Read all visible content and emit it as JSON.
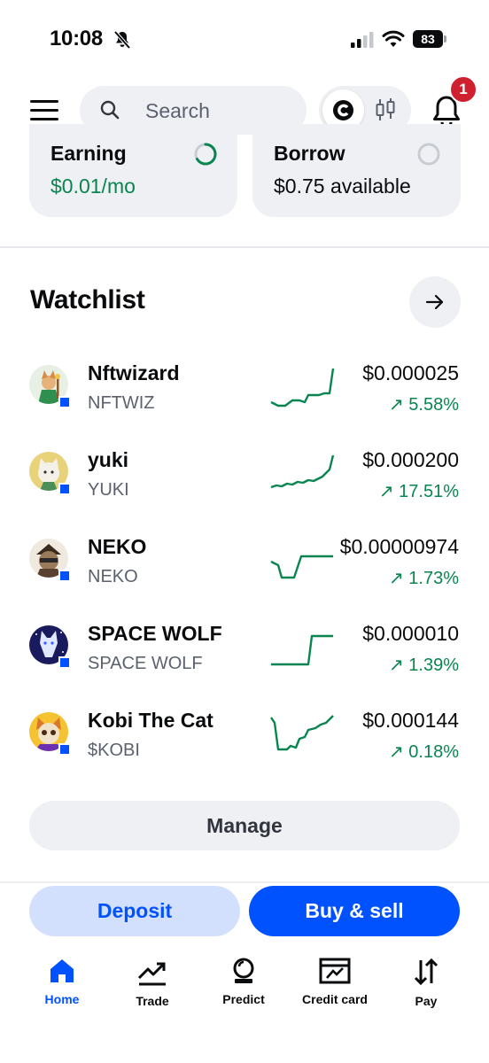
{
  "status_bar": {
    "time": "10:08",
    "battery": "83"
  },
  "header": {
    "search_placeholder": "Search",
    "notification_count": "1"
  },
  "cards": {
    "earning": {
      "title": "Earning",
      "value": "$0.01/mo"
    },
    "borrow": {
      "title": "Borrow",
      "value": "$0.75 available"
    }
  },
  "watchlist": {
    "title": "Watchlist",
    "items": [
      {
        "name": "Nftwizard",
        "ticker": "NFTWIZ",
        "price": "$0.000025",
        "change": "↗ 5.58%"
      },
      {
        "name": "yuki",
        "ticker": "YUKI",
        "price": "$0.000200",
        "change": "↗ 17.51%"
      },
      {
        "name": "NEKO",
        "ticker": "NEKO",
        "price": "$0.00000974",
        "change": "↗ 1.73%"
      },
      {
        "name": "SPACE WOLF",
        "ticker": "SPACE WOLF",
        "price": "$0.000010",
        "change": "↗ 1.39%"
      },
      {
        "name": "Kobi The Cat",
        "ticker": "$KOBI",
        "price": "$0.000144",
        "change": "↗ 0.18%"
      }
    ],
    "manage_label": "Manage"
  },
  "actions": {
    "deposit_label": "Deposit",
    "buy_sell_label": "Buy & sell"
  },
  "tab_bar": {
    "tabs": [
      {
        "label": "Home",
        "icon": "home-icon",
        "active": true
      },
      {
        "label": "Trade",
        "icon": "trend-up-icon"
      },
      {
        "label": "Predict",
        "icon": "crystal-ball-icon"
      },
      {
        "label": "Credit card",
        "icon": "credit-card-icon"
      },
      {
        "label": "Pay",
        "icon": "transfer-arrows-icon"
      }
    ]
  },
  "colors": {
    "accent_blue": "#0052ff",
    "positive_green": "#098551",
    "surface_gray": "#eef0f3",
    "badge_red": "#cf202f"
  }
}
